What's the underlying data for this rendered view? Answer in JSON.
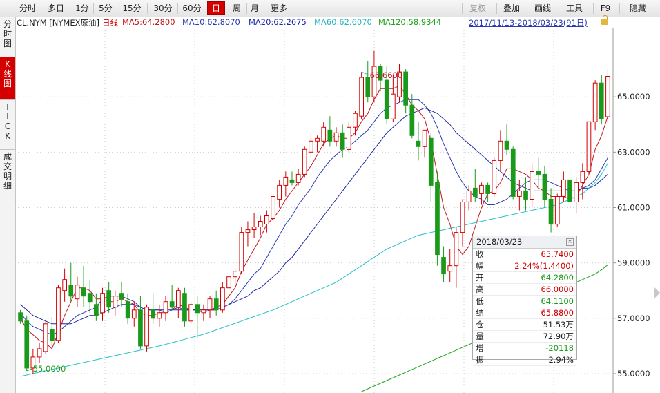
{
  "toolbar": {
    "periods": [
      "分时",
      "多日",
      "1分",
      "5分",
      "15分",
      "30分",
      "60分",
      "日",
      "周",
      "月",
      "更多"
    ],
    "active_period": "日",
    "actions": [
      "复权",
      "叠加",
      "画线",
      "工具",
      "F9",
      "隐藏"
    ]
  },
  "sidebar": {
    "tabs": [
      "分\n时\n图",
      "K\n线\n图",
      "T\nI\nC\nK",
      "成\n交\n明\n细"
    ]
  },
  "legend": {
    "symbol": "CL.NYM [NYMEX原油]",
    "period": "日线",
    "ma5": "MA5:64.2800",
    "ma10": "MA10:62.8070",
    "ma20": "MA20:62.2675",
    "ma60": "MA60:62.6070",
    "ma120": "MA120:58.9344",
    "range": "2017/11/13-2018/03/23(91日)"
  },
  "colors": {
    "up": "#d40000",
    "down": "#1a9a1a",
    "ma5": "#c0161d",
    "ma10": "#2a3ab4",
    "ma20": "#1b2aa6",
    "ma60": "#22c2c8",
    "ma120": "#1aa51a"
  },
  "chart_data": {
    "type": "candlestick",
    "ylim": [
      54.3,
      67.5
    ],
    "y_ticks": [
      "55.0000",
      "57.0000",
      "59.0000",
      "61.0000",
      "63.0000",
      "65.0000"
    ],
    "y_tick_values": [
      55,
      57,
      59,
      61,
      63,
      65
    ],
    "annotations": {
      "high_label": "66.6600",
      "low_label": "55.0000",
      "high_index": 54,
      "low_index": 1
    },
    "candles": [
      [
        57.2,
        57.3,
        56.8,
        56.9
      ],
      [
        56.9,
        57.1,
        55.1,
        55.2
      ],
      [
        55.2,
        55.9,
        55.0,
        55.6
      ],
      [
        55.6,
        56.1,
        55.4,
        55.9
      ],
      [
        55.8,
        56.9,
        55.7,
        56.8
      ],
      [
        56.6,
        57.0,
        56.0,
        56.2
      ],
      [
        56.2,
        58.2,
        56.1,
        58.1
      ],
      [
        58.0,
        58.8,
        57.6,
        58.4
      ],
      [
        58.2,
        59.0,
        57.6,
        57.8
      ],
      [
        57.7,
        58.5,
        57.4,
        58.2
      ],
      [
        58.1,
        58.9,
        57.4,
        57.8
      ],
      [
        57.9,
        58.4,
        57.2,
        57.6
      ],
      [
        57.5,
        57.9,
        56.9,
        57.1
      ],
      [
        57.2,
        58.1,
        56.9,
        57.9
      ],
      [
        58.0,
        58.3,
        57.2,
        57.4
      ],
      [
        57.4,
        58.0,
        57.1,
        57.8
      ],
      [
        57.9,
        58.3,
        57.4,
        57.7
      ],
      [
        57.6,
        57.9,
        56.8,
        57.0
      ],
      [
        57.0,
        57.6,
        56.7,
        57.3
      ],
      [
        57.3,
        57.8,
        55.9,
        56.0
      ],
      [
        56.0,
        57.5,
        55.8,
        57.4
      ],
      [
        57.3,
        57.9,
        56.8,
        57.0
      ],
      [
        57.0,
        57.5,
        56.7,
        57.2
      ],
      [
        57.2,
        57.8,
        56.9,
        57.6
      ],
      [
        57.6,
        58.2,
        57.3,
        57.4
      ],
      [
        57.4,
        58.1,
        57.0,
        58.0
      ],
      [
        57.9,
        58.1,
        56.7,
        56.9
      ],
      [
        56.9,
        57.6,
        56.8,
        57.5
      ],
      [
        57.5,
        57.8,
        56.3,
        57.2
      ],
      [
        57.2,
        57.5,
        56.9,
        57.3
      ],
      [
        57.3,
        57.8,
        57.0,
        57.7
      ],
      [
        57.7,
        58.0,
        57.1,
        57.3
      ],
      [
        57.3,
        58.3,
        57.2,
        58.1
      ],
      [
        58.1,
        58.7,
        57.8,
        58.5
      ],
      [
        58.5,
        58.8,
        58.2,
        58.7
      ],
      [
        58.7,
        60.3,
        58.6,
        60.1
      ],
      [
        60.1,
        60.5,
        59.6,
        60.2
      ],
      [
        60.2,
        60.8,
        59.9,
        60.3
      ],
      [
        60.3,
        60.7,
        60.0,
        60.5
      ],
      [
        60.4,
        60.9,
        60.1,
        60.7
      ],
      [
        60.6,
        61.5,
        60.5,
        61.4
      ],
      [
        61.3,
        62.0,
        61.0,
        61.8
      ],
      [
        61.8,
        62.3,
        61.4,
        62.1
      ],
      [
        62.0,
        62.3,
        61.8,
        61.9
      ],
      [
        61.9,
        62.4,
        61.8,
        62.2
      ],
      [
        62.2,
        63.2,
        62.1,
        63.1
      ],
      [
        63.0,
        63.7,
        62.8,
        63.4
      ],
      [
        63.4,
        63.6,
        63.0,
        63.5
      ],
      [
        63.4,
        64.1,
        63.2,
        63.9
      ],
      [
        63.8,
        64.3,
        63.2,
        63.4
      ],
      [
        63.4,
        63.9,
        63.2,
        63.7
      ],
      [
        63.7,
        64.0,
        62.8,
        63.1
      ],
      [
        63.1,
        64.1,
        63.0,
        63.9
      ],
      [
        63.9,
        64.5,
        63.6,
        64.4
      ],
      [
        64.3,
        65.9,
        64.2,
        65.7
      ],
      [
        65.7,
        66.3,
        64.8,
        65.0
      ],
      [
        65.0,
        66.66,
        64.8,
        66.1
      ],
      [
        66.1,
        66.2,
        65.2,
        65.6
      ],
      [
        65.6,
        66.1,
        64.0,
        64.2
      ],
      [
        64.2,
        65.8,
        64.1,
        65.1
      ],
      [
        65.0,
        66.2,
        64.8,
        65.9
      ],
      [
        65.9,
        66.0,
        64.4,
        64.7
      ],
      [
        64.7,
        65.1,
        63.5,
        63.6
      ],
      [
        63.4,
        64.1,
        62.7,
        63.2
      ],
      [
        63.2,
        63.8,
        62.8,
        63.8
      ],
      [
        63.5,
        63.7,
        61.2,
        61.8
      ],
      [
        61.9,
        62.3,
        58.9,
        59.3
      ],
      [
        59.2,
        59.6,
        58.3,
        58.6
      ],
      [
        58.7,
        59.5,
        58.3,
        58.9
      ],
      [
        58.9,
        60.3,
        58.1,
        60.1
      ],
      [
        60.1,
        61.3,
        59.6,
        61.2
      ],
      [
        61.2,
        61.8,
        60.9,
        61.6
      ],
      [
        61.7,
        62.4,
        61.2,
        61.4
      ],
      [
        61.5,
        61.9,
        61.1,
        61.8
      ],
      [
        61.8,
        61.9,
        61.2,
        61.5
      ],
      [
        61.5,
        62.8,
        61.4,
        62.7
      ],
      [
        62.7,
        63.8,
        62.3,
        63.4
      ],
      [
        63.4,
        64.0,
        62.9,
        63.1
      ],
      [
        63.1,
        63.2,
        61.3,
        61.4
      ],
      [
        61.4,
        62.0,
        60.9,
        61.6
      ],
      [
        61.6,
        62.1,
        60.9,
        61.3
      ],
      [
        61.3,
        62.6,
        61.0,
        62.3
      ],
      [
        62.3,
        62.8,
        61.7,
        62.2
      ],
      [
        62.2,
        62.5,
        61.0,
        61.3
      ],
      [
        61.3,
        61.7,
        60.1,
        60.4
      ],
      [
        60.4,
        61.5,
        60.3,
        61.4
      ],
      [
        61.4,
        62.3,
        61.2,
        62.0
      ],
      [
        62.0,
        62.5,
        61.0,
        61.2
      ],
      [
        61.2,
        62.1,
        60.8,
        61.9
      ],
      [
        61.9,
        62.6,
        61.3,
        62.3
      ],
      [
        62.3,
        64.1,
        62.2,
        64.1
      ],
      [
        64.1,
        65.6,
        63.8,
        65.5
      ],
      [
        65.5,
        65.8,
        64.0,
        64.2
      ],
      [
        64.28,
        66.0,
        64.11,
        65.74
      ]
    ],
    "ma_series": [
      {
        "name": "MA5",
        "values": [
          57.0,
          56.6,
          56.4,
          56.2,
          56.1,
          55.9,
          56.5,
          57.1,
          57.6,
          58.1,
          58.1,
          58.0,
          57.7,
          57.7,
          57.6,
          57.6,
          57.7,
          57.6,
          57.5,
          57.2,
          57.1,
          57.1,
          57.2,
          57.2,
          57.3,
          57.5,
          57.4,
          57.3,
          57.3,
          57.2,
          57.3,
          57.4,
          57.5,
          57.8,
          58.1,
          58.7,
          59.1,
          59.5,
          59.9,
          60.4,
          60.6,
          60.9,
          61.3,
          61.6,
          61.9,
          62.2,
          62.5,
          62.9,
          63.3,
          63.5,
          63.6,
          63.5,
          63.5,
          63.7,
          64.1,
          64.4,
          64.9,
          65.3,
          65.3,
          65.3,
          65.4,
          65.1,
          64.7,
          64.5,
          64.2,
          63.4,
          62.2,
          61.0,
          60.4,
          59.6,
          59.3,
          59.6,
          60.3,
          61.0,
          61.5,
          61.6,
          61.9,
          62.4,
          62.4,
          62.3,
          62.2,
          62.0,
          61.7,
          61.6,
          61.4,
          61.4,
          61.4,
          61.3,
          61.4,
          61.8,
          62.2,
          63.1,
          63.6,
          64.3
        ]
      },
      {
        "name": "MA10",
        "values": [
          57.2,
          56.9,
          56.7,
          56.6,
          56.5,
          56.4,
          56.5,
          56.7,
          56.9,
          57.1,
          57.2,
          57.3,
          57.4,
          57.7,
          57.8,
          57.8,
          57.8,
          57.7,
          57.6,
          57.4,
          57.3,
          57.3,
          57.3,
          57.2,
          57.3,
          57.4,
          57.3,
          57.3,
          57.3,
          57.3,
          57.3,
          57.3,
          57.4,
          57.5,
          57.7,
          58.0,
          58.3,
          58.6,
          58.8,
          59.2,
          59.6,
          60.0,
          60.4,
          60.7,
          61.1,
          61.4,
          61.7,
          62.1,
          62.4,
          62.7,
          62.9,
          63.1,
          63.2,
          63.4,
          63.6,
          63.8,
          64.1,
          64.4,
          64.6,
          64.7,
          64.8,
          64.9,
          64.9,
          64.9,
          64.7,
          64.4,
          63.9,
          63.3,
          62.8,
          62.3,
          61.9,
          61.6,
          61.4,
          61.3,
          61.1,
          61.1,
          61.2,
          61.3,
          61.5,
          61.7,
          61.9,
          62.0,
          62.0,
          62.0,
          61.9,
          61.8,
          61.7,
          61.6,
          61.6,
          61.7,
          61.8,
          62.0,
          62.4,
          62.8
        ]
      },
      {
        "name": "MA20",
        "values": [
          57.5,
          57.3,
          57.1,
          57.0,
          56.9,
          56.8,
          56.8,
          56.8,
          56.8,
          56.9,
          57.0,
          57.1,
          57.1,
          57.2,
          57.3,
          57.4,
          57.5,
          57.5,
          57.5,
          57.4,
          57.3,
          57.3,
          57.3,
          57.3,
          57.3,
          57.3,
          57.3,
          57.3,
          57.3,
          57.3,
          57.3,
          57.3,
          57.4,
          57.5,
          57.6,
          57.7,
          57.8,
          58.0,
          58.1,
          58.3,
          58.5,
          58.7,
          59.0,
          59.2,
          59.5,
          59.8,
          60.1,
          60.4,
          60.7,
          61.0,
          61.3,
          61.6,
          61.9,
          62.2,
          62.5,
          62.8,
          63.1,
          63.4,
          63.7,
          63.9,
          64.1,
          64.3,
          64.4,
          64.5,
          64.6,
          64.5,
          64.4,
          64.2,
          64.0,
          63.7,
          63.5,
          63.3,
          63.1,
          62.9,
          62.7,
          62.5,
          62.3,
          62.1,
          61.9,
          61.8,
          61.7,
          61.6,
          61.6,
          61.6,
          61.6,
          61.6,
          61.6,
          61.6,
          61.6,
          61.7,
          61.7,
          61.8,
          62.0,
          62.2
        ]
      },
      {
        "name": "MA60",
        "values": [
          54.9,
          54.95,
          55.0,
          55.05,
          55.1,
          55.15,
          55.2,
          55.25,
          55.3,
          55.35,
          55.4,
          55.45,
          55.5,
          55.55,
          55.6,
          55.65,
          55.7,
          55.75,
          55.8,
          55.85,
          55.9,
          55.95,
          56.0,
          56.06,
          56.12,
          56.18,
          56.24,
          56.3,
          56.36,
          56.42,
          56.5,
          56.58,
          56.66,
          56.74,
          56.82,
          56.9,
          56.98,
          57.06,
          57.14,
          57.22,
          57.3,
          57.4,
          57.5,
          57.6,
          57.7,
          57.8,
          57.9,
          58.0,
          58.1,
          58.2,
          58.3,
          58.45,
          58.6,
          58.75,
          58.9,
          59.05,
          59.2,
          59.35,
          59.5,
          59.6,
          59.7,
          59.8,
          59.9,
          60.0,
          60.05,
          60.1,
          60.15,
          60.2,
          60.25,
          60.3,
          60.35,
          60.4,
          60.45,
          60.5,
          60.55,
          60.6,
          60.65,
          60.7,
          60.75,
          60.8,
          60.85,
          60.9,
          60.95,
          61.0,
          61.05,
          61.1,
          61.2,
          61.3,
          61.4,
          61.5,
          61.7,
          61.9,
          62.2,
          62.6
        ]
      },
      {
        "name": "MA120",
        "values": [
          null,
          null,
          null,
          null,
          null,
          null,
          null,
          null,
          null,
          null,
          null,
          null,
          null,
          null,
          null,
          null,
          null,
          null,
          null,
          null,
          null,
          null,
          null,
          null,
          null,
          null,
          null,
          null,
          null,
          null,
          null,
          null,
          null,
          null,
          null,
          null,
          null,
          null,
          null,
          null,
          null,
          null,
          null,
          null,
          null,
          null,
          null,
          null,
          null,
          null,
          null,
          null,
          null,
          null,
          54.35,
          54.45,
          54.55,
          54.65,
          54.75,
          54.85,
          54.95,
          55.05,
          55.15,
          55.25,
          55.35,
          55.45,
          55.55,
          55.65,
          55.75,
          55.85,
          55.95,
          56.05,
          56.15,
          56.25,
          56.4,
          56.55,
          56.7,
          56.85,
          57.0,
          57.15,
          57.3,
          57.45,
          57.6,
          57.75,
          57.9,
          58.0,
          58.1,
          58.2,
          58.3,
          58.4,
          58.5,
          58.6,
          58.75,
          58.93
        ]
      }
    ]
  },
  "tooltip": {
    "date": "2018/03/23",
    "rows": [
      {
        "k": "收",
        "v": "65.7400",
        "color": "#d40000"
      },
      {
        "k": "幅",
        "v": "2.24%(1.4400)",
        "color": "#d40000"
      },
      {
        "k": "开",
        "v": "64.2800",
        "color": "#1a9a1a"
      },
      {
        "k": "高",
        "v": "66.0000",
        "color": "#d40000"
      },
      {
        "k": "低",
        "v": "64.1100",
        "color": "#1a9a1a"
      },
      {
        "k": "结",
        "v": "65.8800",
        "color": "#d40000"
      },
      {
        "k": "仓",
        "v": "51.53万",
        "color": "#222"
      },
      {
        "k": "量",
        "v": "72.90万",
        "color": "#222"
      },
      {
        "k": "增",
        "v": "-20118",
        "color": "#1a9a1a"
      },
      {
        "k": "振",
        "v": "2.94%",
        "color": "#222"
      }
    ]
  }
}
